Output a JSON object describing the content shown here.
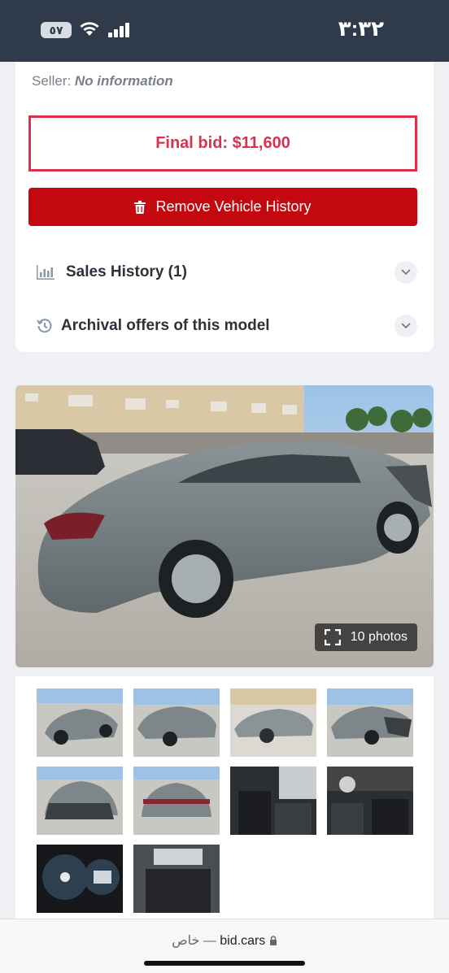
{
  "status_bar": {
    "time": "٣:٣٢",
    "battery": "٥٧"
  },
  "seller": {
    "label": "Seller:",
    "value": "No information"
  },
  "final_bid": {
    "text": "Final bid: $11,600"
  },
  "remove_button": {
    "label": "Remove Vehicle History",
    "color": "#c4080f"
  },
  "sales_history": {
    "label": "Sales History (1)"
  },
  "archival_offers": {
    "label": "Archival offers of this model"
  },
  "gallery": {
    "photos_badge": "10 photos",
    "thumbnail_count": 10
  },
  "url_bar": {
    "domain": "bid.cars",
    "private_label": "خاص —",
    "lock_icon": "lock-icon"
  },
  "colors": {
    "accent_red": "#d9324f",
    "button_red": "#c4080f",
    "status_bar_bg": "#2f3b4a"
  }
}
